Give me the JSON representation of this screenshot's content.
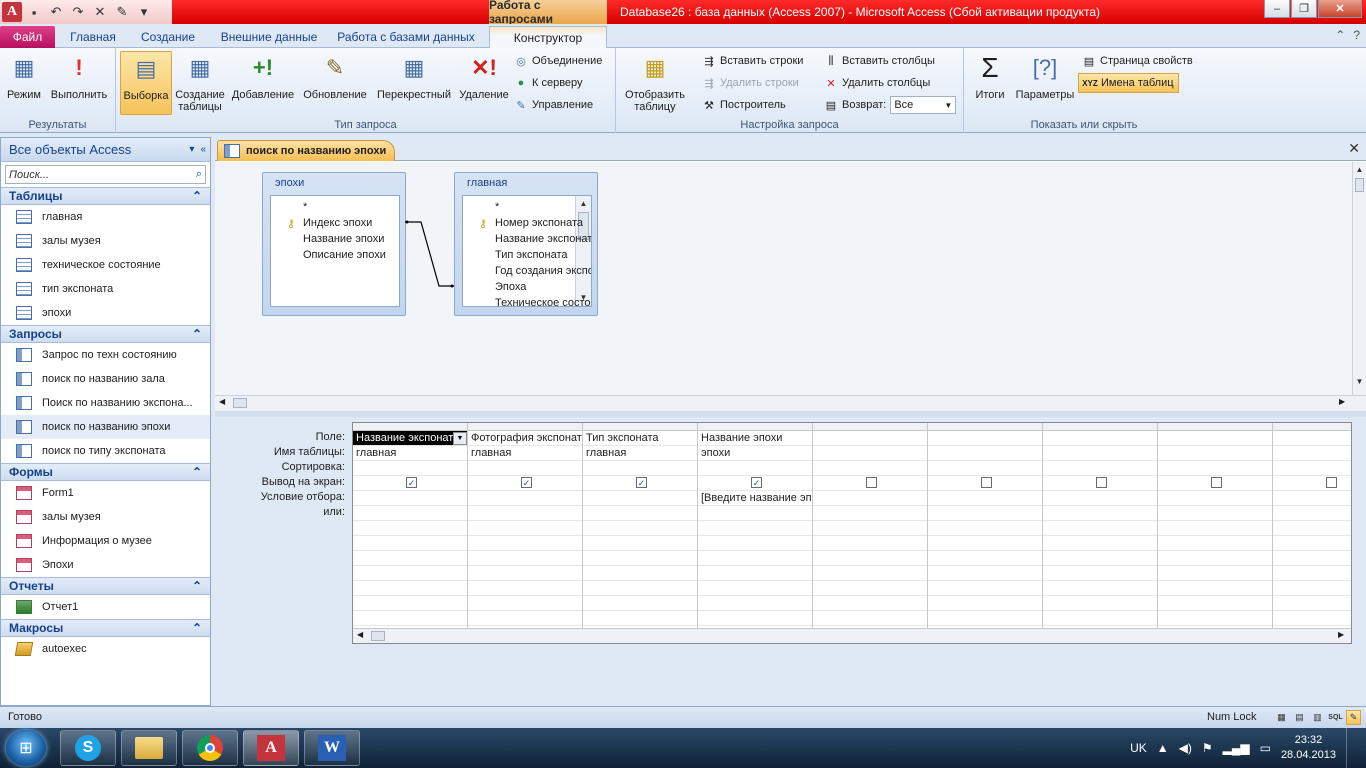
{
  "window": {
    "contextual_tab_group": "Работа с запросами",
    "title": "Database26 : база данных (Access 2007)  -  Microsoft Access (Сбой активации продукта)",
    "logo_letter": "A"
  },
  "ribbon_tabs": {
    "file": "Файл",
    "home": "Главная",
    "create": "Создание",
    "external": "Внешние данные",
    "db_tools": "Работа с базами данных",
    "designer": "Конструктор"
  },
  "ribbon": {
    "results": {
      "label": "Результаты",
      "view": "Режим",
      "run": "Выполнить"
    },
    "query_type": {
      "label": "Тип запроса",
      "select": "Выборка",
      "make_table": "Создание таблицы",
      "append": "Добавление",
      "update": "Обновление",
      "crosstab": "Перекрестный",
      "delete": "Удаление",
      "union": "Объединение",
      "passthrough": "К серверу",
      "data_def": "Управление"
    },
    "setup": {
      "label": "Настройка запроса",
      "show_table": "Отобразить таблицу",
      "insert_rows": "Вставить строки",
      "delete_rows": "Удалить строки",
      "builder": "Построитель",
      "insert_cols": "Вставить столбцы",
      "delete_cols": "Удалить столбцы",
      "return_label": "Возврат:",
      "return_value": "Все"
    },
    "show_hide": {
      "label": "Показать или скрыть",
      "totals": "Итоги",
      "params": "Параметры",
      "property_sheet": "Страница свойств",
      "table_names": "Имена таблиц"
    }
  },
  "nav": {
    "header": "Все объекты Access",
    "search_placeholder": "Поиск...",
    "categories": {
      "tables": "Таблицы",
      "queries": "Запросы",
      "forms": "Формы",
      "reports": "Отчеты",
      "macros": "Макросы"
    },
    "tables": [
      "главная",
      "залы музея",
      "техническое состояние",
      "тип экспоната",
      "эпохи"
    ],
    "queries": [
      "Запрос по техн состоянию",
      "поиск по названию зала",
      "Поиск по названию экспона...",
      "поиск по названию эпохи",
      "поиск по типу экспоната"
    ],
    "forms": [
      "Form1",
      "залы музея",
      "Информация о музее",
      "Эпохи"
    ],
    "reports": [
      "Отчет1"
    ],
    "macros": [
      "autoexec"
    ]
  },
  "document": {
    "tab_title": "поиск по названию эпохи",
    "table1": {
      "title": "эпохи",
      "fields": [
        "*",
        "Индекс эпохи",
        "Название эпохи",
        "Описание эпохи"
      ]
    },
    "table2": {
      "title": "главная",
      "fields": [
        "*",
        "Номер экспоната",
        "Название экспоната",
        "Тип экспоната",
        "Год создания экспоната",
        "Эпоха",
        "Техническое состояние"
      ]
    }
  },
  "grid": {
    "row_labels": [
      "Поле:",
      "Имя таблицы:",
      "Сортировка:",
      "Вывод на экран:",
      "Условие отбора:",
      "или:"
    ],
    "columns": [
      {
        "field": "Название экспоната",
        "table": "главная",
        "show": true,
        "criteria": ""
      },
      {
        "field": "Фотография экспоната",
        "table": "главная",
        "show": true,
        "criteria": ""
      },
      {
        "field": "Тип экспоната",
        "table": "главная",
        "show": true,
        "criteria": ""
      },
      {
        "field": "Название эпохи",
        "table": "эпохи",
        "show": true,
        "criteria": "[Введите название эпохи]"
      },
      {
        "field": "",
        "table": "",
        "show": false,
        "criteria": ""
      },
      {
        "field": "",
        "table": "",
        "show": false,
        "criteria": ""
      },
      {
        "field": "",
        "table": "",
        "show": false,
        "criteria": ""
      },
      {
        "field": "",
        "table": "",
        "show": false,
        "criteria": ""
      },
      {
        "field": "",
        "table": "",
        "show": false,
        "criteria": ""
      }
    ]
  },
  "status": {
    "text": "Готово",
    "numlock": "Num Lock",
    "sql": "SQL"
  },
  "taskbar": {
    "lang": "UK",
    "time": "23:32",
    "date": "28.04.2013",
    "word_letter": "W"
  }
}
